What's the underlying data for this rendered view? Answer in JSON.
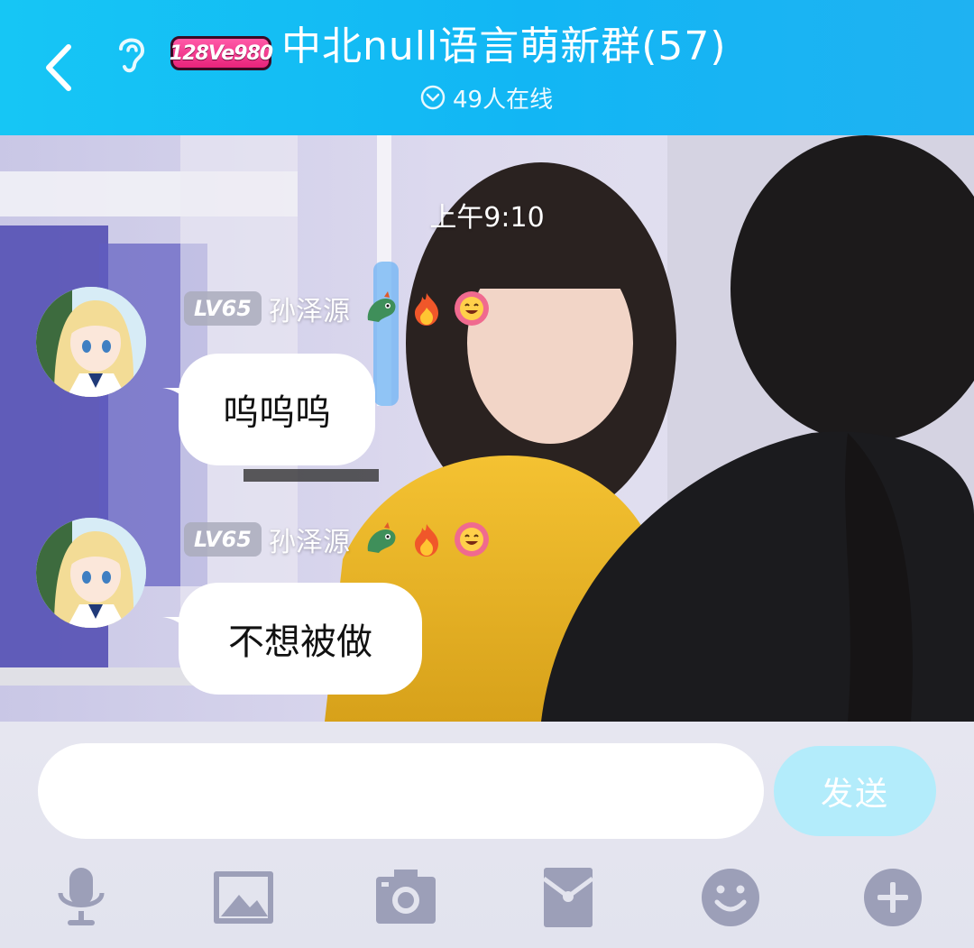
{
  "header": {
    "title": "中北null语言萌新群(57)",
    "level_badge": "128Ve980",
    "online_text": "49人在线"
  },
  "chat": {
    "timestamp": "上午9:10",
    "messages": [
      {
        "level": "LV65",
        "sender": "孙泽源",
        "text": "呜呜呜"
      },
      {
        "level": "LV65",
        "sender": "孙泽源",
        "text": "不想被做"
      }
    ]
  },
  "input": {
    "placeholder": "",
    "send_label": "发送"
  },
  "toolbar": {
    "icons": [
      "microphone-icon",
      "image-icon",
      "camera-icon",
      "red-packet-icon",
      "emoji-icon",
      "plus-icon"
    ]
  },
  "colors": {
    "header": "#12b6f4",
    "send_button": "#b3ecfb",
    "toolbar_icon": "#9c9fb8"
  }
}
